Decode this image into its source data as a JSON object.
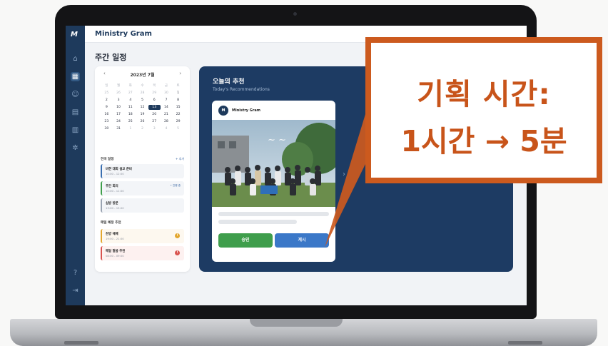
{
  "app": {
    "title": "Ministry Gram",
    "logo": "M"
  },
  "sidebar": {
    "items": [
      "home-icon",
      "calendar-icon",
      "people-icon",
      "clipboard-icon",
      "layout-icon",
      "gear-icon",
      "help-icon",
      "logout-icon"
    ]
  },
  "page": {
    "title": "주간 일정"
  },
  "calendar": {
    "month_label": "2023년 7월",
    "prev": "‹",
    "next": "›",
    "weekdays": [
      "일",
      "월",
      "화",
      "수",
      "목",
      "금",
      "토"
    ],
    "days": [
      "25",
      "26",
      "27",
      "28",
      "29",
      "30",
      "1",
      "2",
      "3",
      "4",
      "5",
      "6",
      "7",
      "8",
      "9",
      "10",
      "11",
      "12",
      "13",
      "14",
      "15",
      "16",
      "17",
      "18",
      "19",
      "20",
      "21",
      "22",
      "23",
      "24",
      "25",
      "26",
      "27",
      "28",
      "29",
      "30",
      "31",
      "1",
      "2",
      "3",
      "4",
      "5"
    ],
    "selected": "13"
  },
  "events": {
    "section_label": "전국 일정",
    "section_action": "+ 추가",
    "items": [
      {
        "title": "비젼 대회 설교 준비",
        "time": "10:00 - 12:00",
        "tag": ""
      },
      {
        "title": "주간 회의",
        "time": "10:00 - 11:00",
        "tag": "• 진행 중"
      },
      {
        "title": "심방 방문",
        "time": "13:00 - 15:00",
        "tag": ""
      }
    ]
  },
  "tasks": {
    "section_label": "매일 예정 추천",
    "items": [
      {
        "title": "찬양 예배",
        "time": "19:00 - 21:00",
        "badge": "!"
      },
      {
        "title": "매일 말씀 추천",
        "time": "08:00 - 09:00",
        "badge": "!"
      }
    ]
  },
  "recommendation": {
    "title": "오늘의 추천",
    "subtitle": "Today's Recommendations",
    "card_logo": "M",
    "card_name": "Ministry Gram",
    "approve_label": "승인",
    "post_label": "게시",
    "next": "›"
  },
  "callout": {
    "line1": "기획 시간:",
    "line2": "1시간 → 5분"
  },
  "colors": {
    "navy": "#1d3b63",
    "accent_orange": "#c8541a",
    "approve_green": "#3f9e4c",
    "post_blue": "#3b78c8"
  }
}
